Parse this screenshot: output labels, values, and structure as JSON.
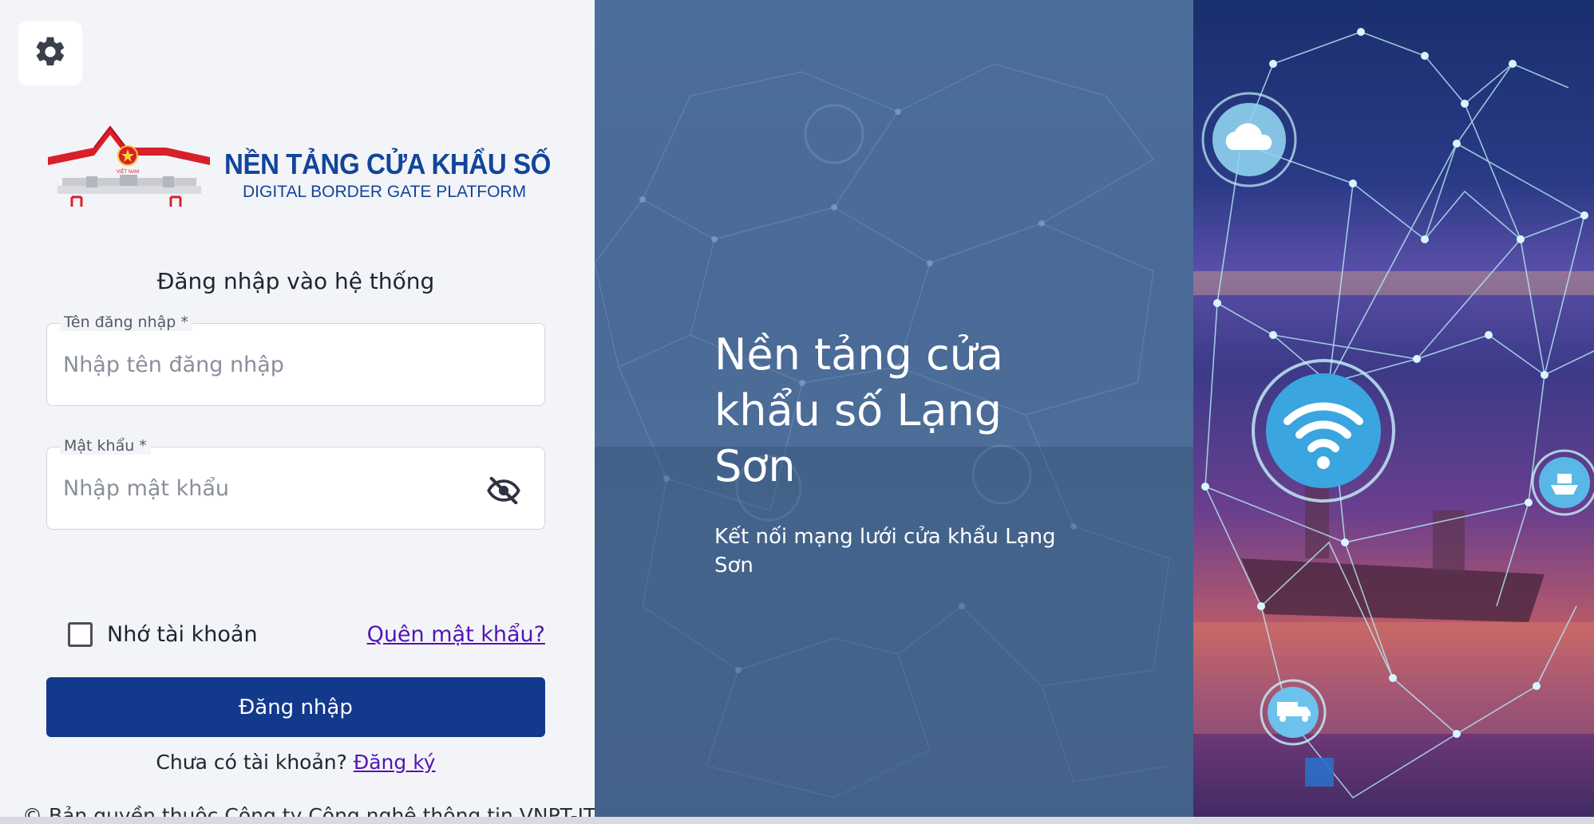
{
  "settings": {
    "icon": "gear-icon"
  },
  "logo": {
    "title": "NỀN TẢNG CỬA KHẨU SỐ",
    "subtitle": "DIGITAL BORDER GATE PLATFORM",
    "emblem_text": "VIỆT NAM"
  },
  "form": {
    "title": "Đăng nhập vào hệ thống",
    "username": {
      "label": "Tên đăng nhập *",
      "placeholder": "Nhập tên đăng nhập",
      "value": ""
    },
    "password": {
      "label": "Mật khẩu *",
      "placeholder": "Nhập mật khẩu",
      "value": "",
      "toggle_icon": "eye-off-icon"
    },
    "remember_label": "Nhớ tài khoản",
    "forgot_label": "Quên mật khẩu?",
    "submit_label": "Đăng nhập",
    "signup_prompt": "Chưa có tài khoản?",
    "signup_link": "Đăng ký"
  },
  "copyright": "© Bản quyền thuộc Công ty Công nghệ thông tin VNPT-IT",
  "hero": {
    "title": "Nền tảng cửa khẩu số Lạng Sơn",
    "subtitle": "Kết nối mạng lưới cửa khẩu Lạng Sơn"
  },
  "colors": {
    "primary": "#13398c",
    "link": "#5216b3",
    "logo_blue": "#12459a",
    "hero_bg": "#4c6e9a"
  },
  "decor_icons": [
    "cloud-icon",
    "wifi-icon",
    "ship-icon",
    "truck-icon"
  ]
}
